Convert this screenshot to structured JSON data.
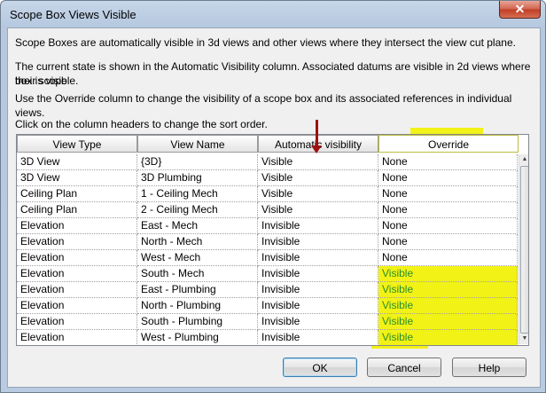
{
  "window": {
    "title": "Scope Box Views Visible",
    "close_label": "✕"
  },
  "intro": {
    "line1": "Scope Boxes are automatically visible in 3d views and other views where they intersect the view cut plane.",
    "line2a": "The current state is shown in the Automatic Visibility column. Associated datums are visible in 2d views where their scope",
    "line2b": "box is visible.",
    "line3": "Use the Override column to change the visibility of a scope box and its associated references in individual views.",
    "line4": "Click on the column headers to change the sort order."
  },
  "table": {
    "columns": [
      "View Type",
      "View Name",
      "Automatic visibility",
      "Override"
    ],
    "rows": [
      [
        "3D View",
        "{3D}",
        "Visible",
        "None"
      ],
      [
        "3D View",
        "3D Plumbing",
        "Visible",
        "None"
      ],
      [
        "Ceiling Plan",
        "1 - Ceiling Mech",
        "Visible",
        "None"
      ],
      [
        "Ceiling Plan",
        "2 - Ceiling Mech",
        "Visible",
        "None"
      ],
      [
        "Elevation",
        "East - Mech",
        "Invisible",
        "None"
      ],
      [
        "Elevation",
        "North - Mech",
        "Invisible",
        "None"
      ],
      [
        "Elevation",
        "West - Mech",
        "Invisible",
        "None"
      ],
      [
        "Elevation",
        "South - Mech",
        "Invisible",
        "Visible"
      ],
      [
        "Elevation",
        "East - Plumbing",
        "Invisible",
        "Visible"
      ],
      [
        "Elevation",
        "North - Plumbing",
        "Invisible",
        "Visible"
      ],
      [
        "Elevation",
        "South - Plumbing",
        "Invisible",
        "Visible"
      ],
      [
        "Elevation",
        "West - Plumbing",
        "Invisible",
        "Visible"
      ]
    ]
  },
  "buttons": {
    "ok": "OK",
    "cancel": "Cancel",
    "help": "Help"
  },
  "colors": {
    "highlight": "#f2f216",
    "arrow": "#a01010",
    "override_visible_text": "#2a8f2a"
  }
}
